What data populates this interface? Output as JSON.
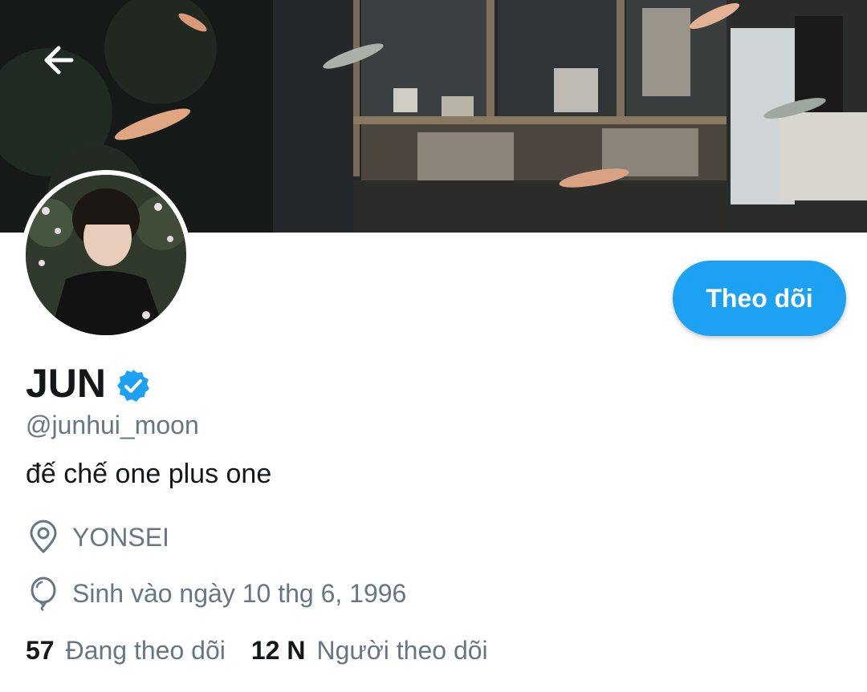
{
  "profile": {
    "display_name": "JUN",
    "handle": "@junhui_moon",
    "bio": "đế chế one plus one",
    "location": "YONSEI",
    "birthday": "Sinh vào ngày 10 thg 6, 1996",
    "verified_icon": "verified-badge-icon",
    "accent_color": "#1da1f2"
  },
  "actions": {
    "follow_label": "Theo dõi",
    "back_icon": "arrow-left-icon"
  },
  "stats": {
    "following_count": "57",
    "following_label": "Đang theo dõi",
    "followers_count": "12 N",
    "followers_label": "Người theo dõi"
  }
}
